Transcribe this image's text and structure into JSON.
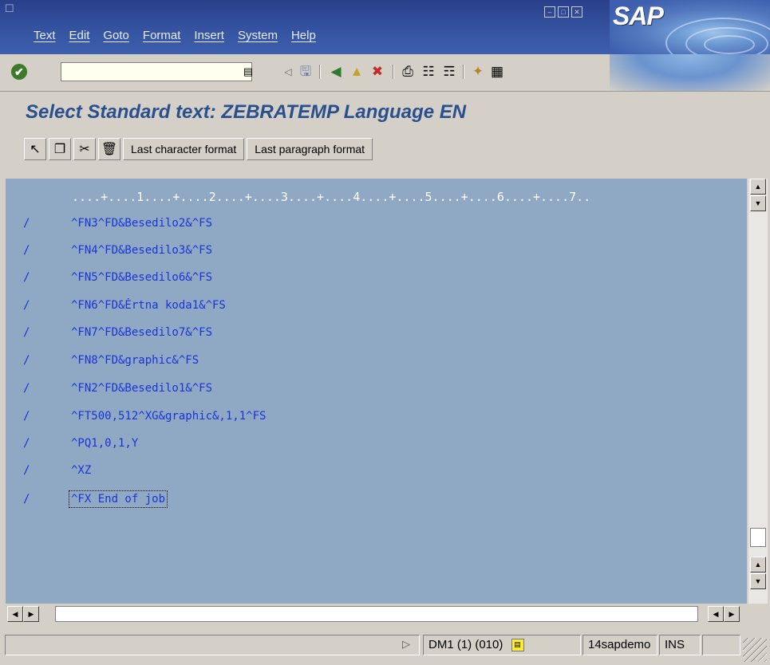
{
  "menu": [
    "Text",
    "Edit",
    "Goto",
    "Format",
    "Insert",
    "System",
    "Help"
  ],
  "brand": "SAP",
  "title": "Select Standard text: ZEBRATEMP Language EN",
  "command_field": {
    "value": ""
  },
  "app_toolbar": {
    "last_char_label": "Last character format",
    "last_para_label": "Last paragraph format"
  },
  "editor": {
    "ruler": "....+....1....+....2....+....3....+....4....+....5....+....6....+....7..",
    "lines": [
      {
        "format": "/",
        "text": "^FN3^FD&Besedilo2&^FS"
      },
      {
        "format": "/",
        "text": "^FN4^FD&Besedilo3&^FS"
      },
      {
        "format": "/",
        "text": "^FN5^FD&Besedilo6&^FS"
      },
      {
        "format": "/",
        "text": "^FN6^FD&Ėrtna koda1&^FS"
      },
      {
        "format": "/",
        "text": "^FN7^FD&Besedilo7&^FS"
      },
      {
        "format": "/",
        "text": "^FN8^FD&graphic&^FS"
      },
      {
        "format": "/",
        "text": "^FN2^FD&Besedilo1&^FS"
      },
      {
        "format": "/",
        "text": "^FT500,512^XG&graphic&,1,1^FS"
      },
      {
        "format": "/",
        "text": "^PQ1,0,1,Y"
      },
      {
        "format": "/",
        "text": "^XZ"
      },
      {
        "format": "/",
        "text": "^FX End of job"
      }
    ]
  },
  "statusbar": {
    "system": "DM1 (1) (010)",
    "server": "14sapdemo",
    "mode": "INS"
  },
  "colors": {
    "menubar": "#33509d",
    "title": "#2a4f8e",
    "editor_bg": "#8fa9c4",
    "editor_text": "#1d33d6"
  }
}
